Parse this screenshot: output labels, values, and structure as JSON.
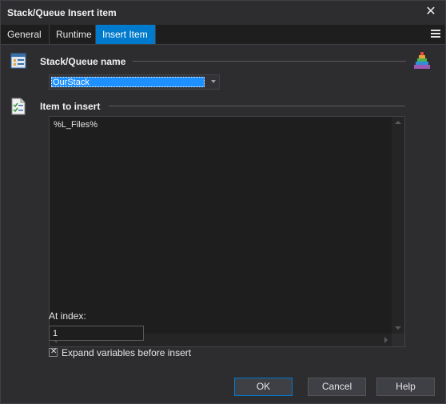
{
  "window": {
    "title": "Stack/Queue Insert item",
    "close_icon": "close-icon"
  },
  "tabs": [
    {
      "label": "General",
      "active": false
    },
    {
      "label": "Runtime",
      "active": false
    },
    {
      "label": "Insert Item",
      "active": true
    }
  ],
  "sections": {
    "stack_name": {
      "label": "Stack/Queue name",
      "icon": "stack-list-icon",
      "select_value": "OurStack",
      "side_icon": "pyramid-icon"
    },
    "item": {
      "label": "Item to insert",
      "icon": "checklist-document-icon",
      "value": "%L_Files%"
    }
  },
  "index": {
    "label": "At index:",
    "value": "1"
  },
  "expand": {
    "label": "Expand variables before insert",
    "checked": true
  },
  "buttons": {
    "ok": "OK",
    "cancel": "Cancel",
    "help": "Help"
  },
  "colors": {
    "accent": "#007acc",
    "background": "#2d2d30",
    "selection": "#1e90ff"
  }
}
